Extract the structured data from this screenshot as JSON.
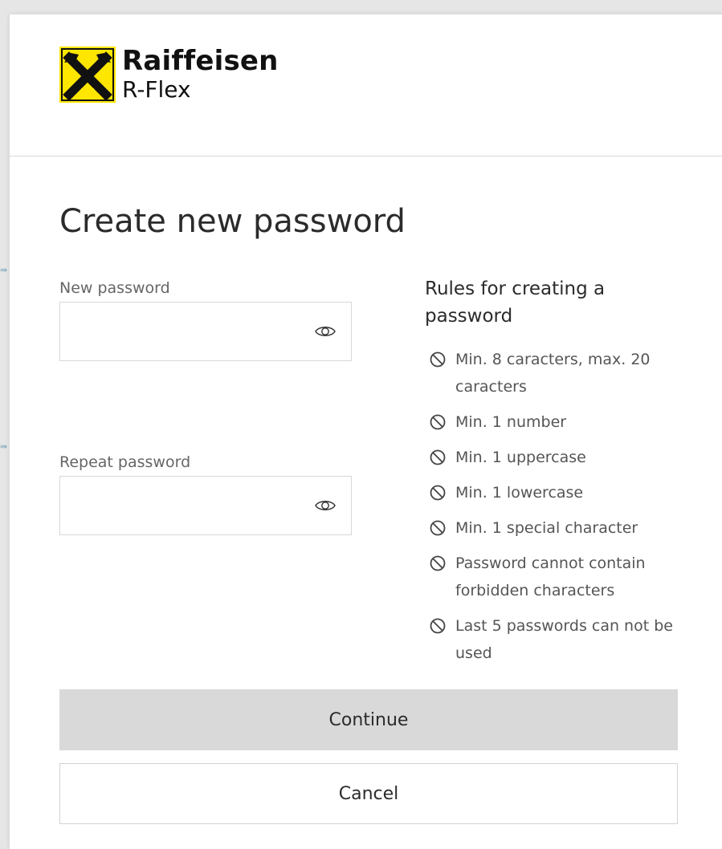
{
  "brand": {
    "name": "Raiffeisen",
    "product": "R-Flex",
    "logo_icon": "raiffeisen-crossed-horse-heads-icon",
    "logo_color": "#fee600"
  },
  "page": {
    "title": "Create new password"
  },
  "form": {
    "new_password": {
      "label": "New password",
      "value": "",
      "placeholder": "",
      "toggle_icon": "eye-icon"
    },
    "repeat_password": {
      "label": "Repeat password",
      "value": "",
      "placeholder": "",
      "toggle_icon": "eye-icon"
    }
  },
  "rules": {
    "title": "Rules for creating a password",
    "status_icon": "ban-icon",
    "items": [
      "Min. 8 caracters, max. 20 caracters",
      "Min. 1 number",
      "Min. 1 uppercase",
      "Min. 1 lowercase",
      "Min. 1 special character",
      "Password cannot contain forbidden characters",
      "Last 5 passwords can not be used"
    ]
  },
  "actions": {
    "continue_label": "Continue",
    "cancel_label": "Cancel"
  },
  "colors": {
    "continue_bg": "#d9d9d9",
    "text": "#2b2b2b",
    "muted": "#666666"
  }
}
